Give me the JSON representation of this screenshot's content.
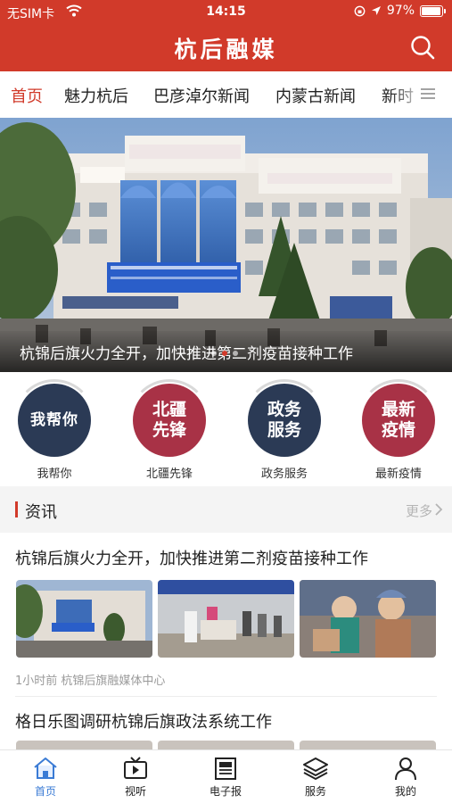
{
  "status_bar": {
    "carrier": "无SIM卡",
    "time": "14:15",
    "battery": "97%",
    "battery_level": 0.97
  },
  "header": {
    "title": "杭后融媒",
    "search_icon": "search-icon"
  },
  "tabs": [
    {
      "label": "首页",
      "active": true
    },
    {
      "label": "魅力杭后",
      "active": false
    },
    {
      "label": "巴彦淖尔新闻",
      "active": false
    },
    {
      "label": "内蒙古新闻",
      "active": false
    },
    {
      "label": "新时",
      "active": false
    }
  ],
  "hero": {
    "caption": "杭锦后旗火力全开，加快推进第二剂疫苗接种工作",
    "slide_count": 3,
    "active_slide": 1
  },
  "quick_entries": [
    {
      "badge": "我帮你",
      "label": "我帮你",
      "color": "#2b3a55"
    },
    {
      "badge": "北疆先锋",
      "label": "北疆先锋",
      "color": "#a83246"
    },
    {
      "badge": "政务服务",
      "label": "政务服务",
      "color": "#2b3a55"
    },
    {
      "badge": "最新疫情",
      "label": "最新疫情",
      "color": "#a83246"
    }
  ],
  "section": {
    "title": "资讯",
    "more_label": "更多"
  },
  "news": [
    {
      "title": "杭锦后旗火力全开，加快推进第二剂疫苗接种工作",
      "meta": "1小时前  杭锦后旗融媒体中心"
    },
    {
      "title": "格日乐图调研杭锦后旗政法系统工作"
    }
  ],
  "bottom_nav": [
    {
      "label": "首页",
      "icon": "home-icon",
      "active": true
    },
    {
      "label": "视听",
      "icon": "tv-icon",
      "active": false
    },
    {
      "label": "电子报",
      "icon": "newspaper-icon",
      "active": false
    },
    {
      "label": "服务",
      "icon": "layers-icon",
      "active": false
    },
    {
      "label": "我的",
      "icon": "person-icon",
      "active": false
    }
  ],
  "colors": {
    "brand": "#d13a2a",
    "nav_active": "#3a7bd5"
  }
}
